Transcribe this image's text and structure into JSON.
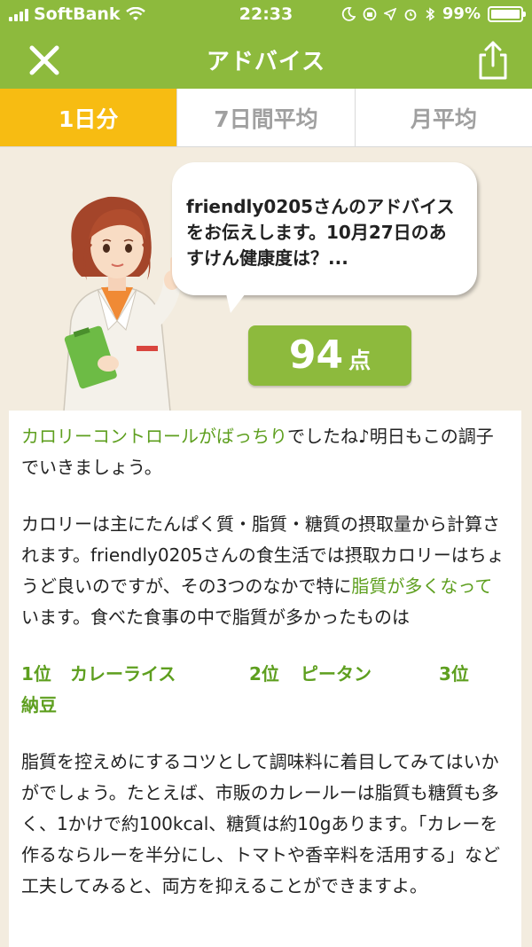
{
  "status_bar": {
    "carrier": "SoftBank",
    "time": "22:33",
    "battery": "99%"
  },
  "nav": {
    "title": "アドバイス",
    "icons": [
      "close-icon",
      "share-icon"
    ]
  },
  "tabs": [
    {
      "label": "1日分",
      "active": true
    },
    {
      "label": "7日間平均",
      "active": false
    },
    {
      "label": "月平均",
      "active": false
    }
  ],
  "advisor": {
    "message": "friendly0205さんのアドバイスをお伝えします。10月27日のあすけん健康度は？...",
    "score": "94",
    "score_unit": "点"
  },
  "advice": {
    "para1_highlight": "カロリーコントロールがばっちり",
    "para1_rest": "でしたね♪明日もこの調子でいきましょう。",
    "para2_a": "カロリーは主にたんぱく質・脂質・糖質の摂取量から計算されます。friendly0205さんの食生活では摂取カロリーはちょうど良いのですが、その3つのなかで特に",
    "para2_highlight": "脂質が多くなって",
    "para2_b": "います。食べた食事の中で脂質が多かったものは",
    "ranks": [
      {
        "rank": "1位",
        "food": "カレーライス"
      },
      {
        "rank": "2位",
        "food": "ピータン"
      },
      {
        "rank": "3位",
        "food": "納豆"
      }
    ],
    "para3": "脂質を控えめにするコツとして調味料に着目してみてはいかがでしょう。たとえば、市販のカレールーは脂質も糖質も多く、1かけで約100kcal、糖質は約10gあります。「カレーを作るならルーを半分にし、トマトや香辛料を活用する」など工夫してみると、両方を抑えることができますよ。"
  },
  "colors": {
    "brand_green": "#8dba3d",
    "active_tab": "#f7bc12",
    "highlight_text": "#5e9f1f",
    "background": "#f3ecdf"
  }
}
